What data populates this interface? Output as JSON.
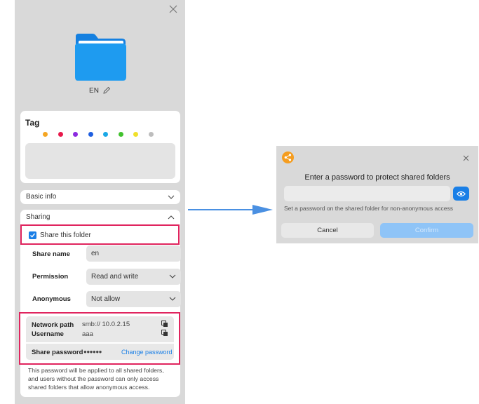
{
  "panel": {
    "folder_name": "EN",
    "tag": {
      "title": "Tag",
      "colors": [
        "#f5a623",
        "#e8194b",
        "#8c2be0",
        "#1f5fe0",
        "#1ba8e6",
        "#41c22e",
        "#f0e02a",
        "#bdbdbd"
      ]
    },
    "basic_info": {
      "label": "Basic info"
    },
    "sharing": {
      "label": "Sharing",
      "share_checkbox_label": "Share this folder",
      "share_name_label": "Share name",
      "share_name_value": "en",
      "permission_label": "Permission",
      "permission_value": "Read and write",
      "anonymous_label": "Anonymous",
      "anonymous_value": "Not allow",
      "network_path_label": "Network path",
      "network_path_value": "smb:// 10.0.2.15",
      "username_label": "Username",
      "username_value": "aaa",
      "share_password_label": "Share password",
      "share_password_value": "●●●●●●",
      "change_password_link": "Change password",
      "note": "This password will be applied to all shared folders, and users without the password can only access shared folders that allow anonymous access."
    }
  },
  "dialog": {
    "title": "Enter a password to protect shared folders",
    "hint": "Set a password on the shared folder for non-anonymous access",
    "cancel_label": "Cancel",
    "confirm_label": "Confirm"
  },
  "colors": {
    "accent": "#1a7fe6",
    "highlight": "#e0245e",
    "folder": "#1e9bf0",
    "logo": "#f59d1f"
  }
}
